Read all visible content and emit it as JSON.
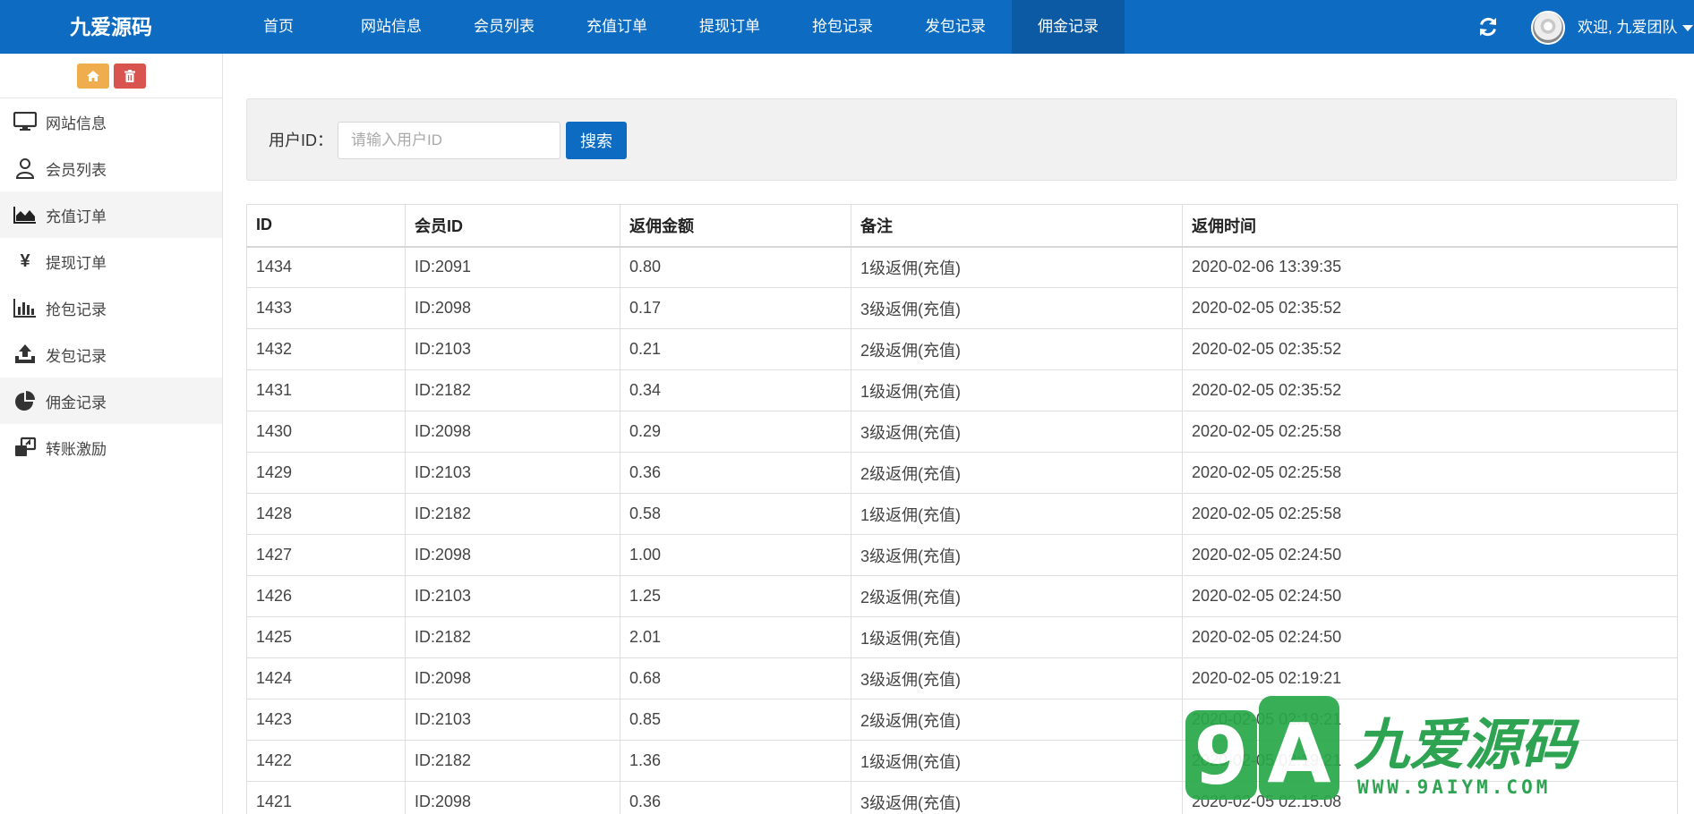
{
  "header": {
    "brand": "九爱源码",
    "nav": [
      "首页",
      "网站信息",
      "会员列表",
      "充值订单",
      "提现订单",
      "抢包记录",
      "发包记录",
      "佣金记录"
    ],
    "active_index": 7,
    "welcome": "欢迎, 九爱团队"
  },
  "sidebar": {
    "items": [
      {
        "label": "网站信息",
        "icon": "monitor-icon"
      },
      {
        "label": "会员列表",
        "icon": "user-icon"
      },
      {
        "label": "充值订单",
        "icon": "area-chart-icon"
      },
      {
        "label": "提现订单",
        "icon": "yen-icon"
      },
      {
        "label": "抢包记录",
        "icon": "bar-chart-icon"
      },
      {
        "label": "发包记录",
        "icon": "upload-icon"
      },
      {
        "label": "佣金记录",
        "icon": "pie-chart-icon"
      },
      {
        "label": "转账激励",
        "icon": "transfer-icon"
      }
    ],
    "highlighted": [
      2,
      6
    ]
  },
  "search": {
    "label": "用户ID：",
    "placeholder": "请输入用户ID",
    "value": "",
    "button": "搜索"
  },
  "table": {
    "columns": [
      "ID",
      "会员ID",
      "返佣金额",
      "备注",
      "返佣时间"
    ],
    "rows": [
      [
        "1434",
        "ID:2091",
        "0.80",
        "1级返佣(充值)",
        "2020-02-06 13:39:35"
      ],
      [
        "1433",
        "ID:2098",
        "0.17",
        "3级返佣(充值)",
        "2020-02-05 02:35:52"
      ],
      [
        "1432",
        "ID:2103",
        "0.21",
        "2级返佣(充值)",
        "2020-02-05 02:35:52"
      ],
      [
        "1431",
        "ID:2182",
        "0.34",
        "1级返佣(充值)",
        "2020-02-05 02:35:52"
      ],
      [
        "1430",
        "ID:2098",
        "0.29",
        "3级返佣(充值)",
        "2020-02-05 02:25:58"
      ],
      [
        "1429",
        "ID:2103",
        "0.36",
        "2级返佣(充值)",
        "2020-02-05 02:25:58"
      ],
      [
        "1428",
        "ID:2182",
        "0.58",
        "1级返佣(充值)",
        "2020-02-05 02:25:58"
      ],
      [
        "1427",
        "ID:2098",
        "1.00",
        "3级返佣(充值)",
        "2020-02-05 02:24:50"
      ],
      [
        "1426",
        "ID:2103",
        "1.25",
        "2级返佣(充值)",
        "2020-02-05 02:24:50"
      ],
      [
        "1425",
        "ID:2182",
        "2.01",
        "1级返佣(充值)",
        "2020-02-05 02:24:50"
      ],
      [
        "1424",
        "ID:2098",
        "0.68",
        "3级返佣(充值)",
        "2020-02-05 02:19:21"
      ],
      [
        "1423",
        "ID:2103",
        "0.85",
        "2级返佣(充值)",
        "2020-02-05 02:19:21"
      ],
      [
        "1422",
        "ID:2182",
        "1.36",
        "1级返佣(充值)",
        "2020-02-05 02:19:21"
      ],
      [
        "1421",
        "ID:2098",
        "0.36",
        "3级返佣(充值)",
        "2020-02-05 02:15:08"
      ]
    ]
  },
  "watermark": {
    "logo": "9A",
    "name": "九爱源码",
    "url": "WWW.9AIYM.COM"
  },
  "colors": {
    "primary": "#0d6cc2",
    "nav_active": "#0b5aa3",
    "home_button": "#f0ad4e",
    "delete_button": "#d9534f",
    "watermark_green": "#2aa84a"
  }
}
